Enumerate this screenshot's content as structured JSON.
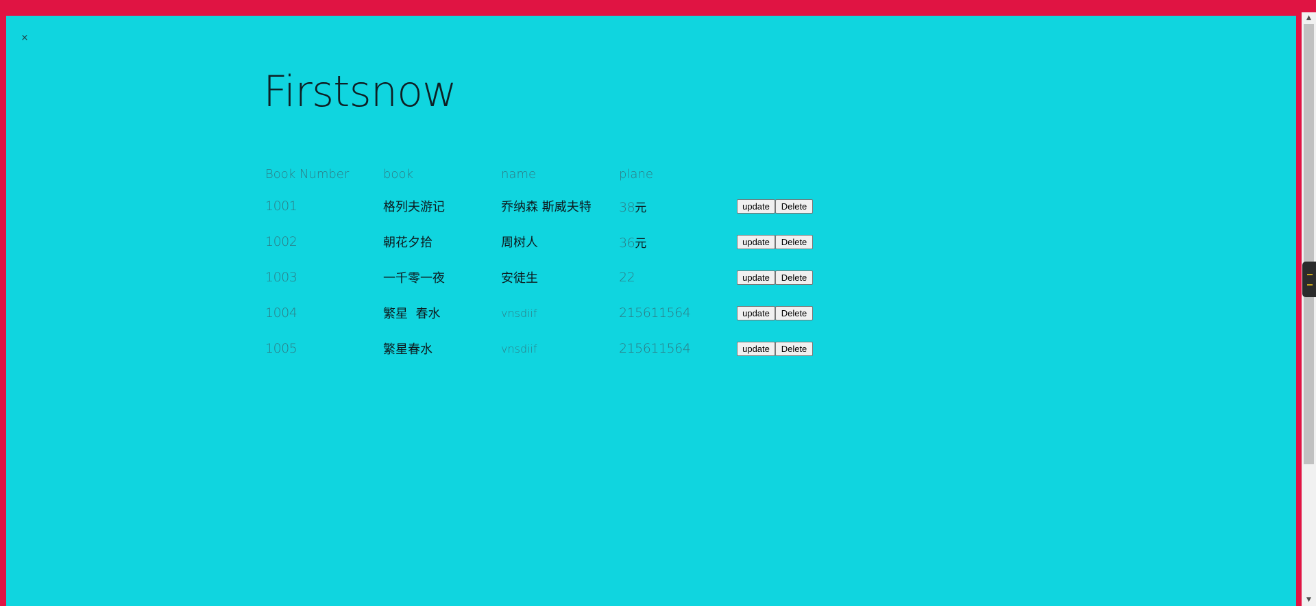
{
  "app": {
    "title": "Firstsnow",
    "close_glyph": "×"
  },
  "table": {
    "headers": {
      "number": "Book Number",
      "book": "book",
      "name": "name",
      "plane": "plane"
    },
    "rows": [
      {
        "number": "1001",
        "book": "格列夫游记",
        "name": "乔纳森 斯威夫特",
        "price_number": "38",
        "price_unit": "元"
      },
      {
        "number": "1002",
        "book": "朝花夕拾",
        "name": "周树人",
        "price_number": "36",
        "price_unit": "元"
      },
      {
        "number": "1003",
        "book": "一千零一夜",
        "name": "安徒生",
        "price_number": "22",
        "price_unit": ""
      },
      {
        "number": "1004",
        "book": "繁星  春水",
        "name": "vnsdiif",
        "price_number": "215611564",
        "price_unit": ""
      },
      {
        "number": "1005",
        "book": "繁星春水",
        "name": "vnsdiif",
        "price_number": "215611564",
        "price_unit": ""
      }
    ],
    "update_label": "update",
    "delete_label": "Delete"
  },
  "colors": {
    "outer_frame": "#e01443",
    "panel_background": "#10d5df",
    "muted_text": "#2e7b85",
    "dark_text": "#0d1b1f"
  },
  "scrollbar": {
    "up_arrow": "▲",
    "down_arrow": "▼"
  }
}
